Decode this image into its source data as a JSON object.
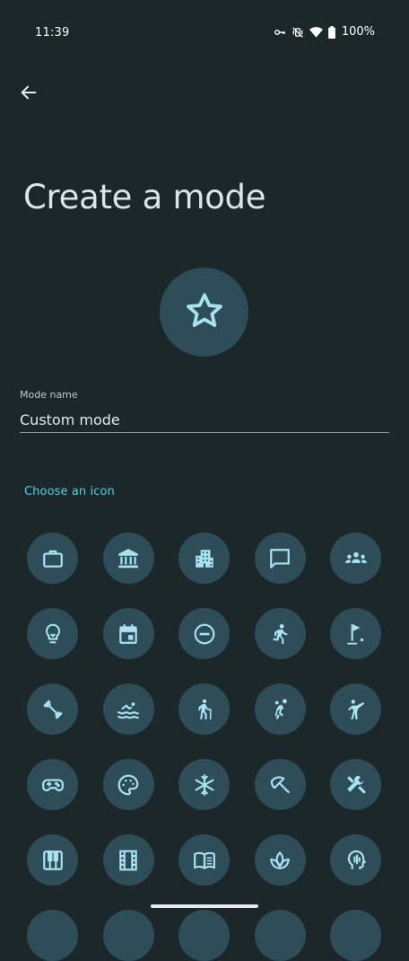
{
  "status_bar": {
    "time": "11:39",
    "battery_text": "100%",
    "icons": [
      "vpn-key-icon",
      "vibrate-off-icon",
      "wifi-icon",
      "battery-icon"
    ]
  },
  "header": {
    "back_icon": "arrow-back-icon",
    "title": "Create a mode"
  },
  "mode_icon": "star-outline-icon",
  "form": {
    "label": "Mode name",
    "value": "Custom mode"
  },
  "icon_section": {
    "label": "Choose an icon",
    "icons": [
      "briefcase-icon",
      "bank-icon",
      "apartment-icon",
      "chat-bubble-icon",
      "groups-icon",
      "lightbulb-icon",
      "calendar-icon",
      "do-not-disturb-icon",
      "running-icon",
      "golf-icon",
      "fitness-dumbbell-icon",
      "swimming-icon",
      "hiking-icon",
      "sports-handball-icon",
      "martial-arts-icon",
      "gamepad-icon",
      "palette-icon",
      "snowflake-icon",
      "beach-umbrella-icon",
      "tools-icon",
      "piano-icon",
      "film-icon",
      "book-open-icon",
      "spa-lotus-icon",
      "head-speaking-icon",
      "partial-icon",
      "partial-icon",
      "partial-icon",
      "partial-icon",
      "partial-icon"
    ]
  },
  "colors": {
    "background": "#1b2729",
    "icon_circle": "#2d4e58",
    "icon_glyph": "#a9e3f0",
    "accent": "#4dd0e1"
  }
}
